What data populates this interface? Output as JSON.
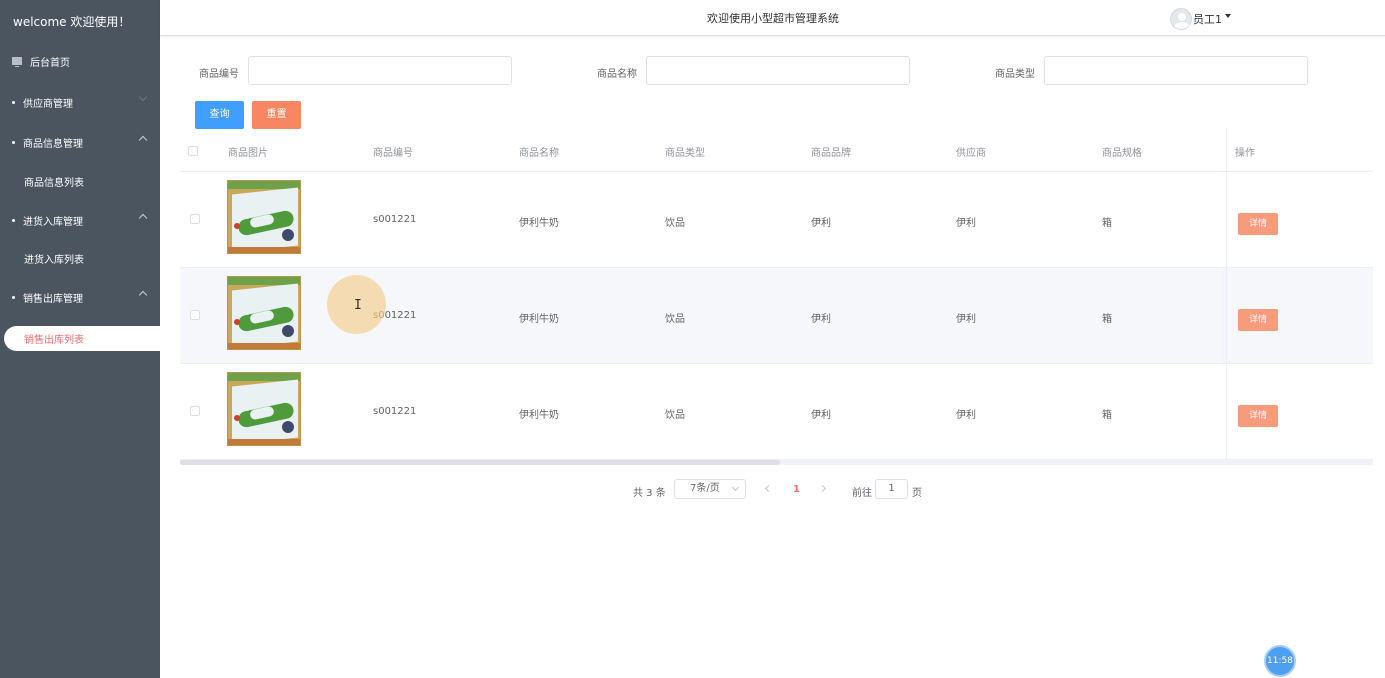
{
  "sidebar": {
    "welcome": "welcome 欢迎使用！",
    "home": "后台首页",
    "groups": [
      {
        "label": "供应商管理"
      },
      {
        "label": "商品信息管理",
        "sub": "商品信息列表"
      },
      {
        "label": "进货入库管理",
        "sub": "进货入库列表"
      },
      {
        "label": "销售出库管理",
        "sub": "销售出库列表"
      }
    ]
  },
  "header": {
    "title": "欢迎使用小型超市管理系统",
    "user": "员工1"
  },
  "search": {
    "code_label": "商品编号",
    "name_label": "商品名称",
    "type_label": "商品类型",
    "query_label": "查询",
    "reset_label": "重置"
  },
  "table": {
    "columns": [
      "商品图片",
      "商品编号",
      "商品名称",
      "商品类型",
      "商品品牌",
      "供应商",
      "商品规格",
      "操作"
    ],
    "rows": [
      {
        "code": "s001221",
        "name": "伊利牛奶",
        "type": "饮品",
        "brand": "伊利",
        "supplier": "伊利",
        "spec": "箱",
        "action": "详情"
      },
      {
        "code": "s001221",
        "name": "伊利牛奶",
        "type": "饮品",
        "brand": "伊利",
        "supplier": "伊利",
        "spec": "箱",
        "action": "详情"
      },
      {
        "code": "s001221",
        "name": "伊利牛奶",
        "type": "饮品",
        "brand": "伊利",
        "supplier": "伊利",
        "spec": "箱",
        "action": "详情"
      }
    ],
    "hovered_row_index": 1
  },
  "pagination": {
    "total": "共 3 条",
    "page_size": "7条/页",
    "current": "1",
    "goto_label": "前往",
    "goto_value": "1",
    "page_suffix": "页"
  },
  "clock": "11:58",
  "colors": {
    "sidebar_bg": "#4a5560",
    "primary": "#409eff",
    "reset": "#f78763",
    "detail": "#f89a7c",
    "active_text": "#f56c6c"
  }
}
